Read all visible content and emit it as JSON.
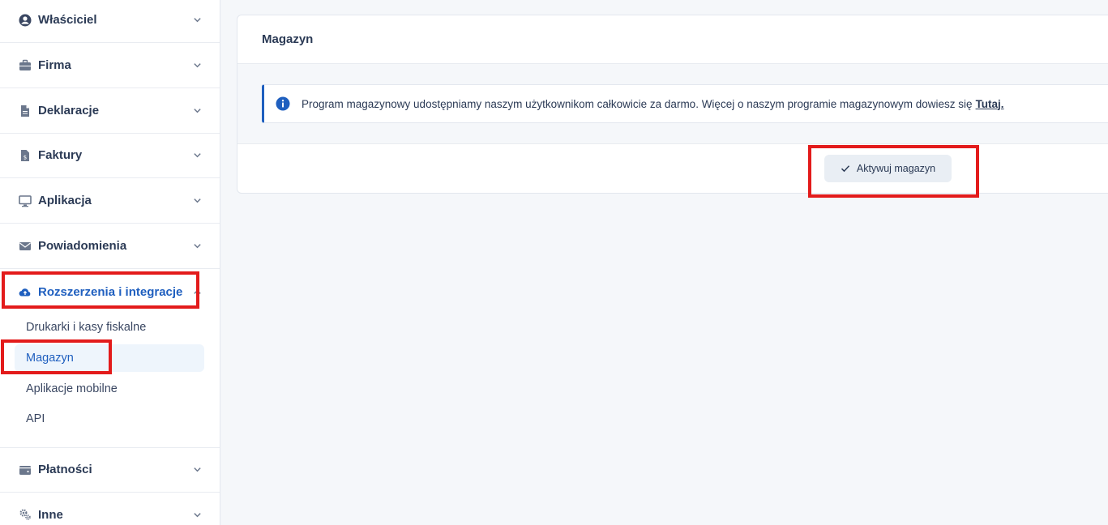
{
  "sidebar": {
    "items": [
      {
        "label": "Właściciel",
        "icon": "user-circle-icon"
      },
      {
        "label": "Firma",
        "icon": "briefcase-icon"
      },
      {
        "label": "Deklaracje",
        "icon": "document-icon"
      },
      {
        "label": "Faktury",
        "icon": "invoice-icon"
      },
      {
        "label": "Aplikacja",
        "icon": "monitor-icon"
      },
      {
        "label": "Powiadomienia",
        "icon": "envelope-icon"
      },
      {
        "label": "Rozszerzenia i integracje",
        "icon": "cloud-upload-icon",
        "expanded": true
      },
      {
        "label": "Płatności",
        "icon": "wallet-icon"
      },
      {
        "label": "Inne",
        "icon": "gears-icon"
      }
    ],
    "subitems": [
      {
        "label": "Drukarki i kasy fiskalne"
      },
      {
        "label": "Magazyn",
        "active": true
      },
      {
        "label": "Aplikacje mobilne"
      },
      {
        "label": "API"
      }
    ]
  },
  "main": {
    "title": "Magazyn",
    "alert": {
      "icon": "info-icon",
      "text": "Program magazynowy udostępniamy naszym użytkownikom całkowicie za darmo. Więcej o naszym programie magazynowym dowiesz się",
      "link": "Tutaj."
    },
    "activate_button": "Aktywuj magazyn",
    "activate_icon": "checkmark-icon"
  },
  "colors": {
    "accent": "#1f5fbf",
    "highlight": "#e31b1b",
    "text": "#2b3a55",
    "background": "#f5f7fa"
  }
}
